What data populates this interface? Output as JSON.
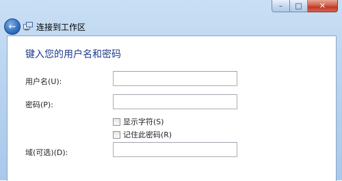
{
  "window": {
    "title": "连接到工作区",
    "caption_buttons": {
      "minimize": "–",
      "maximize": "□",
      "close": "✕"
    }
  },
  "nav": {
    "back_icon": "back-arrow-icon",
    "location_icon": "remoteapp-icon"
  },
  "form": {
    "heading": "键入您的用户名和密码",
    "username_label": "用户名(U):",
    "username_value": "",
    "password_label": "密码(P):",
    "password_value": "",
    "show_chars_label": "显示字符(S)",
    "show_chars_checked": false,
    "remember_label": "记住此密码(R)",
    "remember_checked": false,
    "domain_label": "域(可选)(D):",
    "domain_value": ""
  }
}
